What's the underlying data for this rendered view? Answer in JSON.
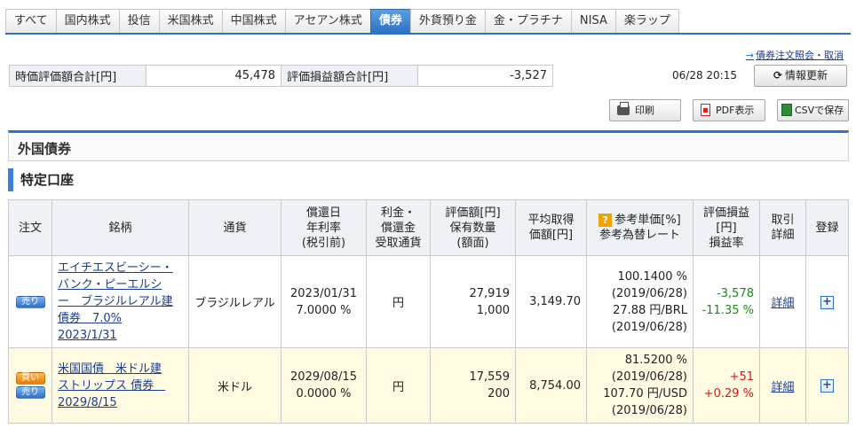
{
  "tabs": [
    {
      "label": "すべて"
    },
    {
      "label": "国内株式"
    },
    {
      "label": "投信"
    },
    {
      "label": "米国株式"
    },
    {
      "label": "中国株式"
    },
    {
      "label": "アセアン株式"
    },
    {
      "label": "債券",
      "active": true
    },
    {
      "label": "外貨預り金"
    },
    {
      "label": "金・プラチナ"
    },
    {
      "label": "NISA"
    },
    {
      "label": "楽ラップ"
    }
  ],
  "order_link": "債券注文照会・取消",
  "summary": {
    "eval_label": "時価評価額合計[円]",
    "eval_value": "45,478",
    "pl_label": "評価損益額合計[円]",
    "pl_value": "-3,527"
  },
  "datetime": "06/28 20:15",
  "buttons": {
    "refresh": "情報更新",
    "print": "印刷",
    "pdf": "PDF表示",
    "csv": "CSVで保存"
  },
  "section_title": "外国債券",
  "account_title": "特定口座",
  "headers": {
    "order": "注文",
    "name": "銘柄",
    "currency": "通貨",
    "redemption": [
      "償還日",
      "年利率",
      "(税引前)"
    ],
    "interest": [
      "利金・",
      "償還金",
      "受取通貨"
    ],
    "valuation": [
      "評価額[円]",
      "保有数量",
      "(額面)"
    ],
    "avg_cost": [
      "平均取得",
      "価額[円]"
    ],
    "ref_price": [
      "参考単価[%]",
      "参考為替レート"
    ],
    "pl": [
      "評価損益",
      "[円]",
      "損益率"
    ],
    "trade": [
      "取引",
      "詳細"
    ],
    "register": "登録"
  },
  "rows": [
    {
      "badges": [
        "売り"
      ],
      "name": [
        "エイチエスビーシー・",
        "バンク・ピーエルシ",
        "ー　ブラジルレアル建",
        "債券　7.0%",
        "2023/1/31"
      ],
      "currency": "ブラジルレアル",
      "redemption_date": "2023/01/31",
      "rate": "7.0000 %",
      "receive_currency": "円",
      "valuation": "27,919",
      "quantity": "1,000",
      "avg_cost": "3,149.70",
      "ref_price": "100.1400 %",
      "ref_price_date": "(2019/06/28)",
      "fx_rate": "27.88 円/BRL",
      "fx_date": "(2019/06/28)",
      "pl": "-3,578",
      "pl_rate": "-11.35 %",
      "detail": "詳細",
      "register": "+"
    },
    {
      "badges": [
        "買い",
        "売り"
      ],
      "name": [
        "米国国債　米ドル建",
        "ストリップス 債券　",
        "2029/8/15"
      ],
      "currency": "米ドル",
      "redemption_date": "2029/08/15",
      "rate": "0.0000 %",
      "receive_currency": "円",
      "valuation": "17,559",
      "quantity": "200",
      "avg_cost": "8,754.00",
      "ref_price": "81.5200 %",
      "ref_price_date": "(2019/06/28)",
      "fx_rate": "107.70 円/USD",
      "fx_date": "(2019/06/28)",
      "pl": "+51",
      "pl_rate": "+0.29 %",
      "detail": "詳細",
      "register": "+"
    }
  ],
  "colors": {
    "accent": "#2d73c4",
    "positive": "#d11a1a",
    "negative": "#1a8a1a",
    "highlight_row": "#fffbe3"
  }
}
